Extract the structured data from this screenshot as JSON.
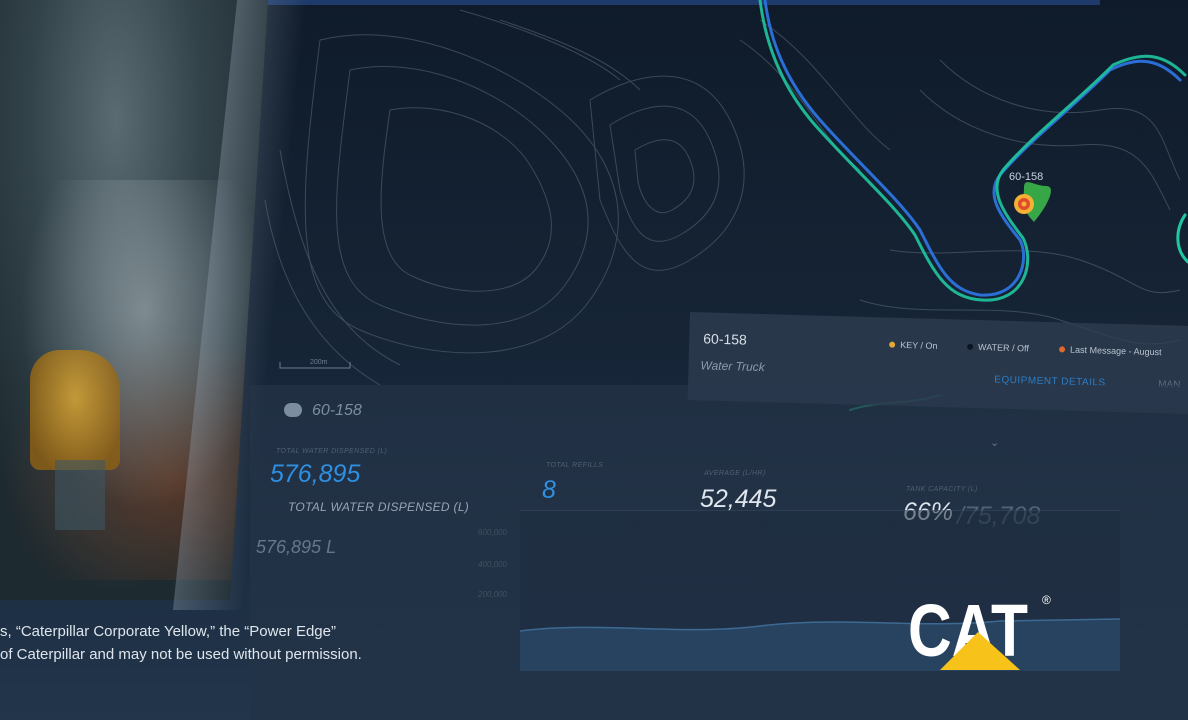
{
  "vehicle": {
    "id": "60-158",
    "type": "Water Truck",
    "map_label": "60-158"
  },
  "map": {
    "scale_label": "200m"
  },
  "card_status": [
    {
      "label": "KEY / On",
      "color": "#e3a836"
    },
    {
      "label": "WATER / Off",
      "color": "#0c1622"
    },
    {
      "label": "Last Message - August",
      "color": "#e06a2c"
    }
  ],
  "card_links": {
    "equipment_details": "EQUIPMENT DETAILS",
    "more": "MAN"
  },
  "dashboard": {
    "title": "60-158",
    "total_water_label": "TOTAL WATER DISPENSED (L)",
    "total_water_value": "576,895",
    "total_water_caption": "TOTAL WATER DISPENSED (L)",
    "total_water_liters": "576,895 L",
    "refills_label": "TOTAL REFILLS",
    "refills_value": "8",
    "average_label": "AVERAGE (L/HR)",
    "average_value": "52,445",
    "tank_label": "TANK CAPACITY (L)",
    "tank_percent": "66%",
    "tank_capacity": "/75,708",
    "axis_ticks": [
      "600,000",
      "400,000",
      "200,000"
    ]
  },
  "legal": {
    "line1": "s, “Caterpillar Corporate Yellow,” the “Power Edge”",
    "line2": "of Caterpillar and may not be used without permission."
  },
  "brand": {
    "logo_text": "CAT",
    "registered": "®",
    "colors": {
      "cat_yellow": "#f7c21a",
      "route_green": "#1fc7a0",
      "route_blue": "#2b6fd6",
      "accent_blue": "#2f8fe0"
    }
  }
}
